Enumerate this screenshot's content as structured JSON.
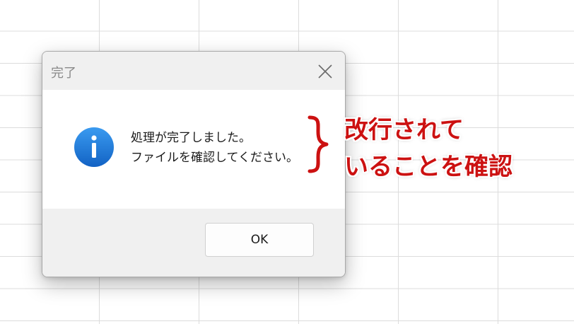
{
  "dialog": {
    "title": "完了",
    "icon": "info-icon",
    "message": "処理が完了しました。\nファイルを確認してください。",
    "ok_label": "OK"
  },
  "annotation": {
    "text": "改行されて\nいることを確認",
    "brace": "}",
    "color": "#cc1111"
  },
  "colors": {
    "accent_icon": "#1a73d9",
    "grid": "#dcdcdc"
  }
}
